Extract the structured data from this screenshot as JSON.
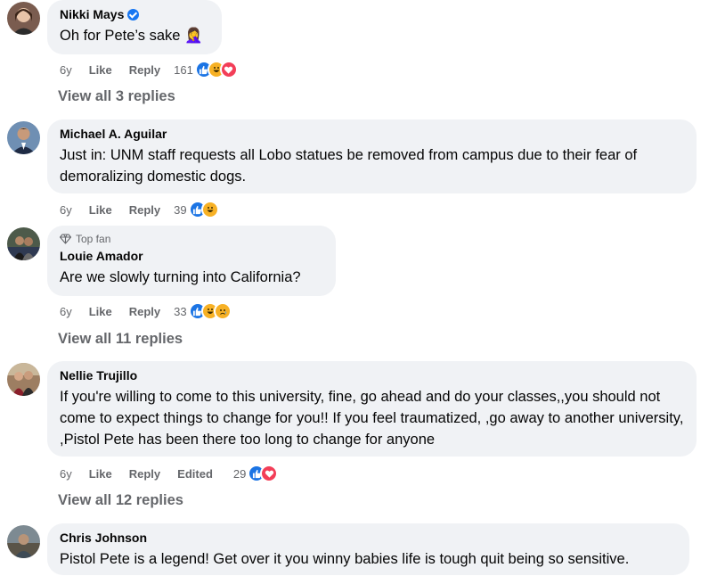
{
  "comments": [
    {
      "name": "Nikki Mays",
      "verified": true,
      "text": "Oh for Pete’s sake 🤦‍♀️",
      "time": "6y",
      "like_label": "Like",
      "reply_label": "Reply",
      "reaction_count": "161",
      "reactions": [
        "like",
        "haha",
        "love"
      ],
      "view_replies": "View all 3 replies"
    },
    {
      "name": "Michael A. Aguilar",
      "text": "Just in: UNM staff requests all Lobo statues be removed from campus due to their fear of demoralizing domestic dogs.",
      "time": "6y",
      "like_label": "Like",
      "reply_label": "Reply",
      "reaction_count": "39",
      "reactions": [
        "like",
        "haha"
      ]
    },
    {
      "badge": "Top fan",
      "name": "Louie Amador",
      "text": "Are we slowly turning into California?",
      "time": "6y",
      "like_label": "Like",
      "reply_label": "Reply",
      "reaction_count": "33",
      "reactions": [
        "like",
        "haha",
        "sad"
      ],
      "view_replies": "View all 11 replies"
    },
    {
      "name": "Nellie Trujillo",
      "text": "If you're willing to come to this university, fine, go ahead and do your classes,,you should not come to expect things to change for you!! If you feel traumatized, ,go away to another university, ,Pistol Pete has been there too long to change for anyone",
      "time": "6y",
      "like_label": "Like",
      "reply_label": "Reply",
      "edited_label": "Edited",
      "reaction_count": "29",
      "reactions": [
        "like",
        "love"
      ],
      "view_replies": "View all 12 replies"
    },
    {
      "name": "Chris Johnson",
      "text": "Pistol Pete is a legend! Get over it you winny babies life is tough quit being so sensitive."
    }
  ]
}
